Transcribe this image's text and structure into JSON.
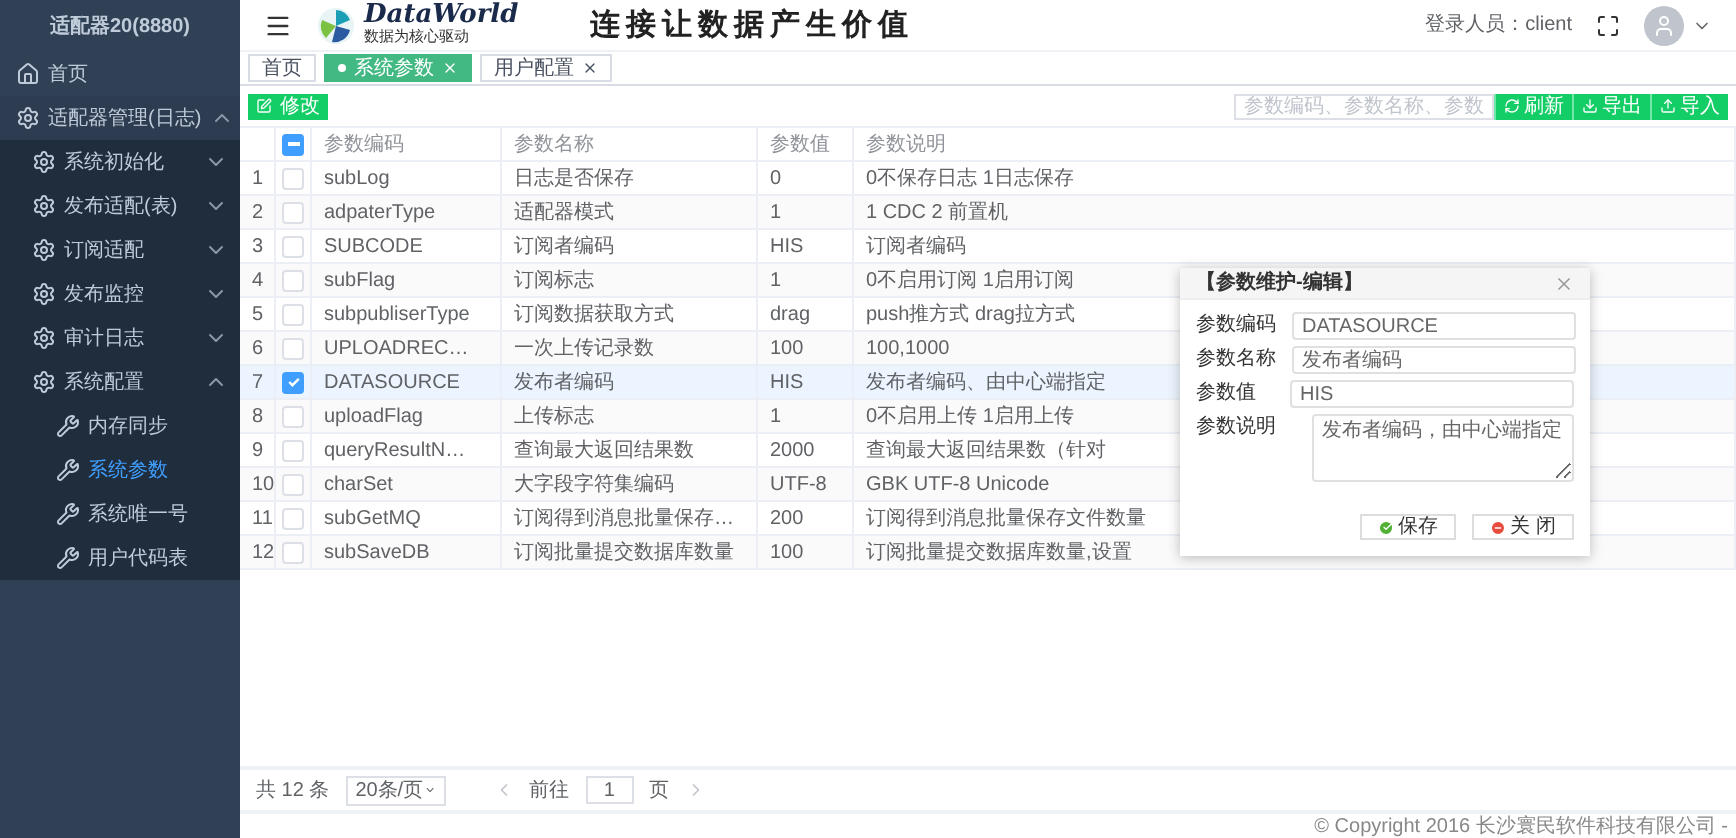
{
  "sidebar": {
    "title": "适配器20(8880)",
    "items": [
      {
        "label": "首页",
        "kind": "home",
        "selected": false
      },
      {
        "label": "适配器管理(日志)",
        "kind": "group",
        "selected": false,
        "expanded": true,
        "children": [
          {
            "label": "系统初始化",
            "kind": "group",
            "selected": false,
            "expanded": false
          },
          {
            "label": "发布适配(表)",
            "kind": "group",
            "selected": false,
            "expanded": false
          },
          {
            "label": "订阅适配",
            "kind": "group",
            "selected": false,
            "expanded": false
          },
          {
            "label": "发布监控",
            "kind": "group",
            "selected": false,
            "expanded": false
          },
          {
            "label": "审计日志",
            "kind": "group",
            "selected": false,
            "expanded": false
          },
          {
            "label": "系统配置",
            "kind": "group",
            "selected": false,
            "expanded": true,
            "children": [
              {
                "label": "内存同步",
                "kind": "leaf",
                "selected": false
              },
              {
                "label": "系统参数",
                "kind": "leaf",
                "selected": true
              },
              {
                "label": "系统唯一号",
                "kind": "leaf",
                "selected": false
              },
              {
                "label": "用户代码表",
                "kind": "leaf",
                "selected": false
              }
            ]
          }
        ]
      }
    ]
  },
  "header": {
    "logo_name": "DataWorld",
    "logo_tagline": "数据为核心驱动",
    "slogan": "连接让数据产生价值",
    "user_label": "登录人员：client"
  },
  "tabs": [
    {
      "label": "首页",
      "selected": false,
      "closable": false
    },
    {
      "label": "系统参数",
      "selected": true,
      "closable": true
    },
    {
      "label": "用户配置",
      "selected": false,
      "closable": true
    }
  ],
  "toolbar": {
    "edit_button": "修改",
    "search": {
      "placeholder": "参数编码、参数名称、参数"
    },
    "buttons": [
      {
        "label": "刷新",
        "kind": "refresh"
      },
      {
        "label": "导出",
        "kind": "export"
      },
      {
        "label": "导入",
        "kind": "import"
      }
    ]
  },
  "table": {
    "columns": [
      "参数编码",
      "参数名称",
      "参数值",
      "参数说明"
    ],
    "header_checkbox": {
      "indeterminate": true
    },
    "rows": [
      {
        "index": "1",
        "code": "subLog",
        "name": "日志是否保存",
        "value": "0",
        "description": "0不保存日志 1日志保存",
        "selected": false
      },
      {
        "index": "2",
        "code": "adpaterType",
        "name": "适配器模式",
        "value": "1",
        "description": "1 CDC 2 前置机",
        "selected": false
      },
      {
        "index": "3",
        "code": "SUBCODE",
        "name": "订阅者编码",
        "value": "HIS",
        "description": "订阅者编码",
        "selected": false
      },
      {
        "index": "4",
        "code": "subFlag",
        "name": "订阅标志",
        "value": "1",
        "description": "0不启用订阅 1启用订阅",
        "selected": false
      },
      {
        "index": "5",
        "code": "subpubliserType",
        "name": "订阅数据获取方式",
        "value": "drag",
        "description": "push推方式 drag拉方式",
        "selected": false
      },
      {
        "index": "6",
        "code": "UPLOADREC…",
        "name": "一次上传记录数",
        "value": "100",
        "description": "100,1000",
        "selected": false
      },
      {
        "index": "7",
        "code": "DATASOURCE",
        "name": "发布者编码",
        "value": "HIS",
        "description": "发布者编码、由中心端指定",
        "selected": true
      },
      {
        "index": "8",
        "code": "uploadFlag",
        "name": "上传标志",
        "value": "1",
        "description": "0不启用上传 1启用上传",
        "selected": false
      },
      {
        "index": "9",
        "code": "queryResultN…",
        "name": "查询最大返回结果数",
        "value": "2000",
        "description": "查询最大返回结果数（针对",
        "selected": false
      },
      {
        "index": "10",
        "code": "charSet",
        "name": "大字段字符集编码",
        "value": "UTF-8",
        "description": "GBK UTF-8 Unicode",
        "selected": false
      },
      {
        "index": "11",
        "code": "subGetMQ",
        "name": "订阅得到消息批量保存…",
        "value": "200",
        "description": "订阅得到消息批量保存文件数量",
        "selected": false
      },
      {
        "index": "12",
        "code": "subSaveDB",
        "name": "订阅批量提交数据库数量",
        "value": "100",
        "description": "订阅批量提交数据库数量,设置",
        "selected": false
      }
    ]
  },
  "dialog": {
    "title": "【参数维护-编辑】",
    "fields": [
      {
        "label": "参数编码",
        "value": "DATASOURCE",
        "kind": "input"
      },
      {
        "label": "参数名称",
        "value": "发布者编码",
        "kind": "input"
      },
      {
        "label": "参数值",
        "value": "HIS",
        "kind": "input"
      },
      {
        "label": "参数说明",
        "value": "发布者编码，由中心端指定",
        "kind": "textarea"
      }
    ],
    "buttons": [
      {
        "label": "保存",
        "kind": "save"
      },
      {
        "label": "关 闭",
        "kind": "close"
      }
    ]
  },
  "pagination": {
    "total": "共 12 条",
    "page_size": "20条/页",
    "goto_label": "前往",
    "page": "1",
    "page_suffix": "页"
  },
  "footer": "© Copyright 2016 长沙寰民软件科技有限公司 -"
}
